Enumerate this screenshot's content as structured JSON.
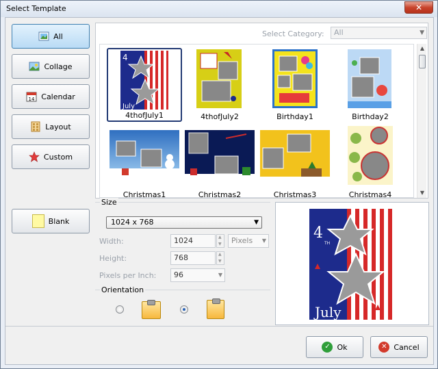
{
  "window": {
    "title": "Select Template",
    "close_glyph": "✕"
  },
  "left_buttons": [
    {
      "label": "All",
      "icon": "picture-icon",
      "active": true
    },
    {
      "label": "Collage",
      "icon": "landscape-icon"
    },
    {
      "label": "Calendar",
      "icon": "calendar-icon",
      "icon_text": "14"
    },
    {
      "label": "Layout",
      "icon": "grid-icon"
    },
    {
      "label": "Custom",
      "icon": "star-icon"
    }
  ],
  "blank_button": {
    "label": "Blank",
    "icon": "blank-page-icon"
  },
  "category": {
    "label": "Select Category:",
    "value": "All"
  },
  "templates": [
    {
      "name": "4thofJuly1",
      "selected": true,
      "bg": "#1d2b8c",
      "accent": "#d62828"
    },
    {
      "name": "4thofJuly2",
      "bg": "#d7cf16",
      "accent": "#c62828"
    },
    {
      "name": "Birthday1",
      "bg": "#2b72c9",
      "accent": "#f4e31c"
    },
    {
      "name": "Birthday2",
      "bg": "#bcd9f5",
      "accent": "#e8483f"
    },
    {
      "name": "Christmas1",
      "bg": "#4b8fd6",
      "accent": "#ffffff"
    },
    {
      "name": "Christmas2",
      "bg": "#0a1a55",
      "accent": "#cc2c2c"
    },
    {
      "name": "Christmas3",
      "bg": "#f2c21c",
      "accent": "#2d7a2d"
    },
    {
      "name": "Christmas4",
      "bg": "#fbf4c9",
      "accent": "#c93232"
    }
  ],
  "size": {
    "legend": "Size",
    "preset": "1024 x 768",
    "width_label": "Width:",
    "width_value": "1024",
    "unit": "Pixels",
    "height_label": "Height:",
    "height_value": "768",
    "ppi_label": "Pixels per Inch:",
    "ppi_value": "96"
  },
  "orientation": {
    "legend": "Orientation",
    "selected": "portrait"
  },
  "preview": {
    "line1": "4",
    "line2": "TH",
    "line3": "July"
  },
  "actions": {
    "ok_label": "Ok",
    "cancel_label": "Cancel"
  }
}
